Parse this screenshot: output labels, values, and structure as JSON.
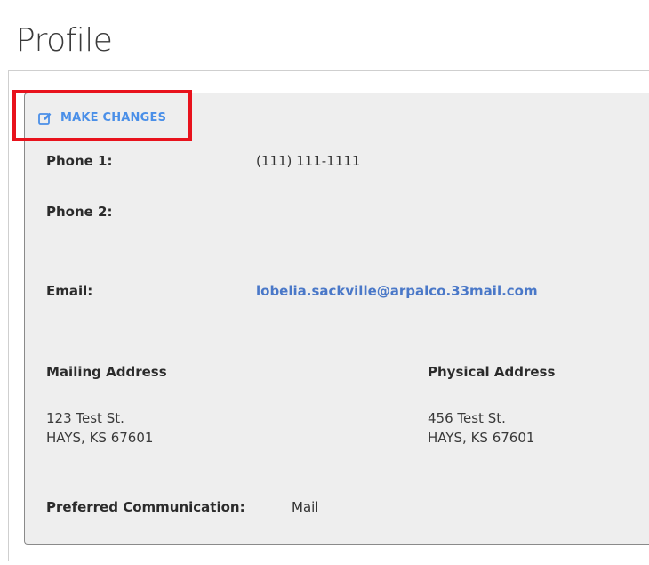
{
  "page": {
    "title": "Profile"
  },
  "toolbar": {
    "make_changes_label": "MAKE CHANGES",
    "make_changes_icon": "edit-icon"
  },
  "contact": {
    "phone1_label": "Phone 1:",
    "phone1_value": "(111) 111-1111",
    "phone2_label": "Phone 2:",
    "phone2_value": "",
    "email_label": "Email:",
    "email_value": "lobelia.sackville@arpalco.33mail.com"
  },
  "addresses": {
    "mailing": {
      "label": "Mailing Address",
      "line1": "123 Test St.",
      "line2": "HAYS, KS 67601"
    },
    "physical": {
      "label": "Physical Address",
      "line1": "456 Test St.",
      "line2": "HAYS, KS 67601"
    }
  },
  "preferences": {
    "communication_label": "Preferred Communication:",
    "communication_value": "Mail"
  },
  "colors": {
    "accent": "#4a8fe8",
    "email_link": "#4a78c8",
    "highlight": "#e8121c",
    "panel_bg": "#eeeeee"
  }
}
